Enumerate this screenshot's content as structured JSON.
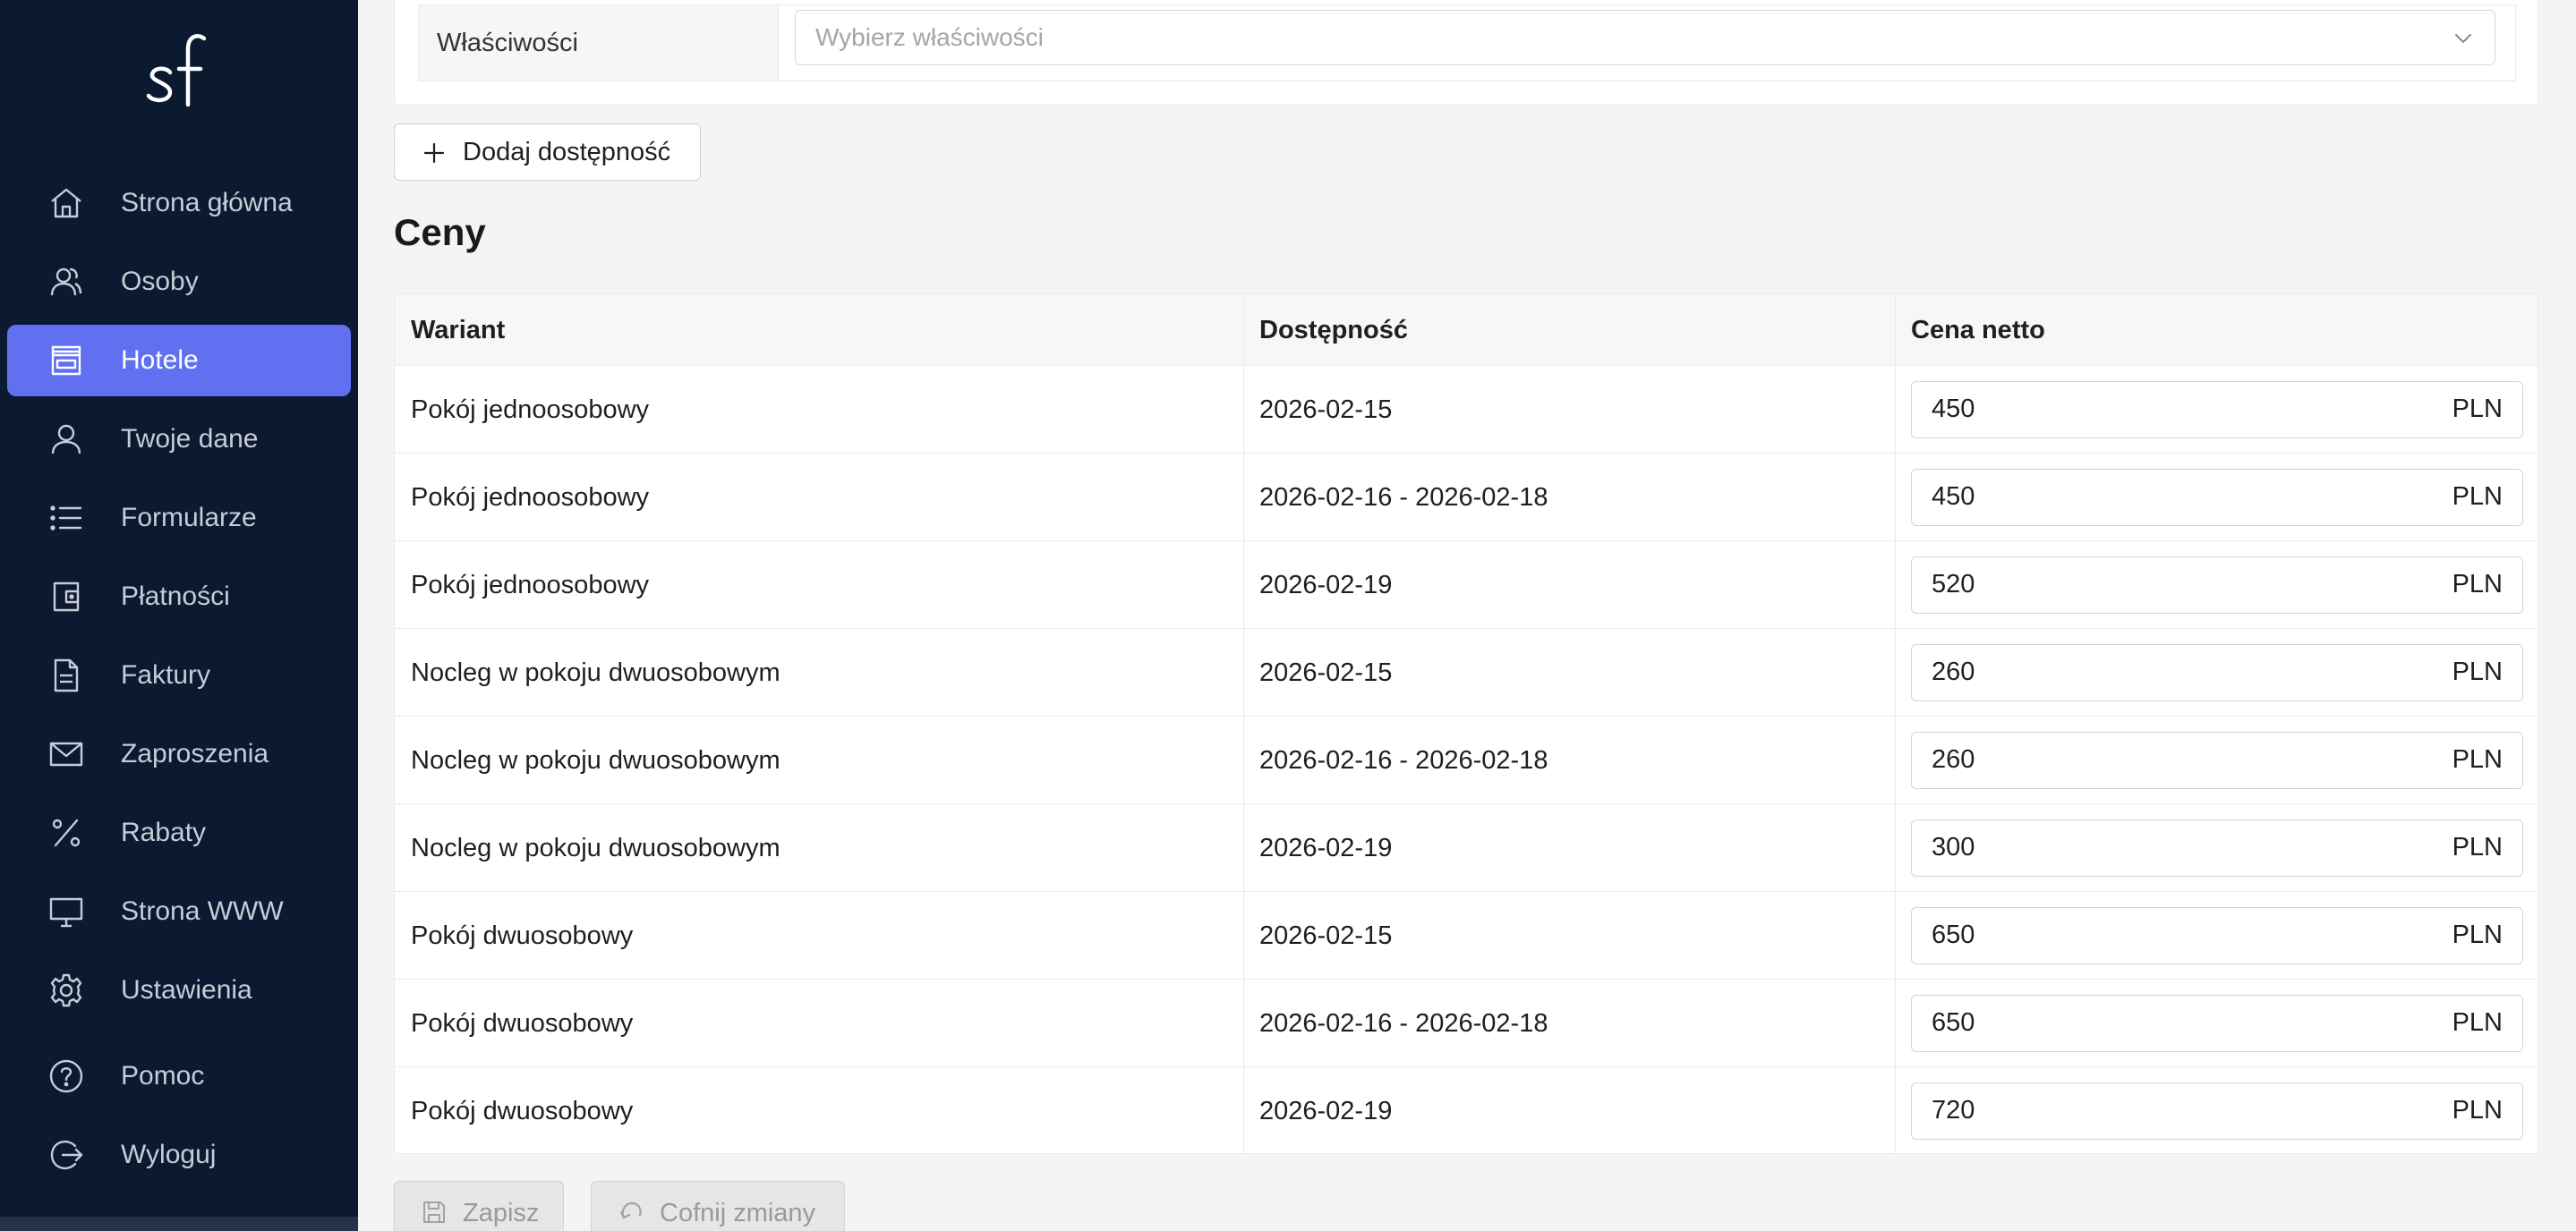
{
  "app": {
    "logo_text": "sf"
  },
  "sidebar": {
    "items": [
      {
        "label": "Strona główna",
        "icon": "home-icon"
      },
      {
        "label": "Osoby",
        "icon": "people-icon"
      },
      {
        "label": "Hotele",
        "icon": "hotel-icon",
        "active": true
      },
      {
        "label": "Twoje dane",
        "icon": "user-icon"
      },
      {
        "label": "Formularze",
        "icon": "list-icon"
      },
      {
        "label": "Płatności",
        "icon": "wallet-icon"
      },
      {
        "label": "Faktury",
        "icon": "invoice-icon"
      },
      {
        "label": "Zaproszenia",
        "icon": "mail-icon"
      },
      {
        "label": "Rabaty",
        "icon": "percent-icon"
      },
      {
        "label": "Strona WWW",
        "icon": "monitor-icon"
      },
      {
        "label": "Ustawienia",
        "icon": "gear-icon"
      },
      {
        "label": "Pomoc",
        "icon": "help-icon"
      },
      {
        "label": "Wyloguj",
        "icon": "logout-icon"
      }
    ]
  },
  "properties": {
    "label": "Właściwości",
    "placeholder": "Wybierz właściwości"
  },
  "add_availability_button": "Dodaj dostępność",
  "prices_section": {
    "title": "Ceny",
    "columns": [
      "Wariant",
      "Dostępność",
      "Cena netto"
    ],
    "currency": "PLN",
    "rows": [
      {
        "variant": "Pokój jednoosobowy",
        "availability": "2026-02-15",
        "price": "450"
      },
      {
        "variant": "Pokój jednoosobowy",
        "availability": "2026-02-16 - 2026-02-18",
        "price": "450"
      },
      {
        "variant": "Pokój jednoosobowy",
        "availability": "2026-02-19",
        "price": "520"
      },
      {
        "variant": "Nocleg w pokoju dwuosobowym",
        "availability": "2026-02-15",
        "price": "260"
      },
      {
        "variant": "Nocleg w pokoju dwuosobowym",
        "availability": "2026-02-16 - 2026-02-18",
        "price": "260"
      },
      {
        "variant": "Nocleg w pokoju dwuosobowym",
        "availability": "2026-02-19",
        "price": "300"
      },
      {
        "variant": "Pokój dwuosobowy",
        "availability": "2026-02-15",
        "price": "650"
      },
      {
        "variant": "Pokój dwuosobowy",
        "availability": "2026-02-16 - 2026-02-18",
        "price": "650"
      },
      {
        "variant": "Pokój dwuosobowy",
        "availability": "2026-02-19",
        "price": "720"
      }
    ]
  },
  "actions": {
    "save": "Zapisz",
    "revert": "Cofnij zmiany"
  },
  "colors": {
    "sidebar_bg": "#0b1931",
    "active_item": "#6070f0",
    "page_bg": "#f4f4f4"
  }
}
